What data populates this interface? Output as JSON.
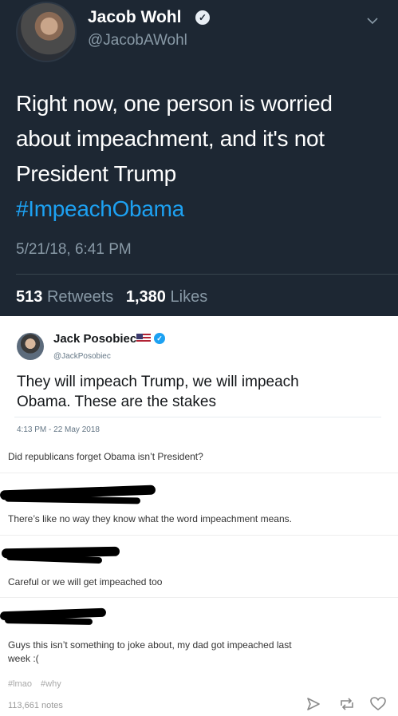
{
  "tweet": {
    "display_name": "Jacob Wohl",
    "handle": "@JacobAWohl",
    "text_line1": "Right now, one person is worried",
    "text_line2": "about impeachment, and it's not",
    "text_line3": "President Trump",
    "hashtag": "#ImpeachObama",
    "date": "5/21/18, 6:41 PM",
    "retweets_count": "513",
    "retweets_label": "Retweets",
    "likes_count": "1,380",
    "likes_label": "Likes",
    "verified_icon": "verified-check-icon",
    "menu_icon": "chevron-down-icon"
  },
  "quoted_tweet": {
    "display_name": "Jack Posobiec",
    "handle": "@JackPosobiec",
    "text_line1": "They will impeach Trump, we will impeach",
    "text_line2": "Obama. These are the stakes",
    "date": "4:13 PM - 22 May 2018",
    "flag_icon": "us-flag-icon",
    "verified_icon": "verified-check-icon"
  },
  "comments": [
    {
      "text": "Did republicans forget Obama isn’t President?"
    },
    {
      "text": "There’s like no way they know what the word impeachment means."
    },
    {
      "text": "Careful or we will get impeached too"
    },
    {
      "text_line1": "Guys this isn’t something to joke about, my dad got impeached last",
      "text_line2": "week :("
    }
  ],
  "tags": [
    "#lmao",
    "#why"
  ],
  "notes": "113,661 notes",
  "actions": [
    "share-icon",
    "reblog-icon",
    "heart-icon"
  ],
  "colors": {
    "dark_bg": "#1d2733",
    "hashtag_blue": "#1da1f2",
    "muted_gray": "#8899a6"
  }
}
